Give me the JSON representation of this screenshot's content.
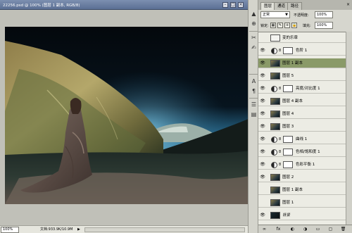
{
  "document": {
    "title": "22256.psd @ 100% (图层 1 副本, RGB/8)",
    "zoom": "100%",
    "doc_info": "文档:933.9K/10.9M",
    "status_arrow": "▶"
  },
  "window_buttons": {
    "minimize": "–",
    "maximize": "□",
    "close": "×"
  },
  "panel": {
    "tabs": [
      "图层",
      "通道",
      "路径"
    ],
    "close_symbol": "×",
    "blend_mode": "正常",
    "opacity_label": "不透明度:",
    "opacity_value": "100%",
    "lock_label": "锁定:",
    "fill_label": "填充:",
    "fill_value": "100%"
  },
  "layers": [
    {
      "name": "变的乐章",
      "kind": "text",
      "selected": false,
      "visible": false
    },
    {
      "name": "色阶 1",
      "kind": "adjustment",
      "selected": false,
      "visible": true
    },
    {
      "name": "图层 1 副本",
      "kind": "image",
      "selected": true,
      "visible": true
    },
    {
      "name": "图层 5",
      "kind": "image",
      "selected": false,
      "visible": true
    },
    {
      "name": "亮度/对比度 1",
      "kind": "adjustment",
      "selected": false,
      "visible": true
    },
    {
      "name": "图层 4 副本",
      "kind": "image",
      "selected": false,
      "visible": true
    },
    {
      "name": "图层 4",
      "kind": "image",
      "selected": false,
      "visible": true
    },
    {
      "name": "图层 3",
      "kind": "image",
      "selected": false,
      "visible": true
    },
    {
      "name": "曲线 1",
      "kind": "adjustment",
      "selected": false,
      "visible": true
    },
    {
      "name": "色相/饱和度 1",
      "kind": "adjustment",
      "selected": false,
      "visible": true
    },
    {
      "name": "色彩平衡 1",
      "kind": "adjustment",
      "selected": false,
      "visible": true
    },
    {
      "name": "图层 2",
      "kind": "image",
      "selected": false,
      "visible": true
    },
    {
      "name": "图层 1 副本",
      "kind": "image",
      "selected": false,
      "visible": false
    },
    {
      "name": "图层 1",
      "kind": "image",
      "selected": false,
      "visible": false
    },
    {
      "name": "背景",
      "kind": "background",
      "selected": false,
      "visible": true
    }
  ],
  "icons": {
    "eye": "👁",
    "chain": "8",
    "tools": [
      "▲",
      "⊕",
      "✂",
      "✍",
      "A",
      "¶",
      "☰",
      "▤"
    ],
    "locks": [
      "▦",
      "✎",
      "✛",
      "🔒"
    ],
    "bottom": [
      "∞",
      "fx",
      "◐",
      "◑",
      "▭",
      "▢",
      "🗑"
    ]
  },
  "colors": {
    "selected_row": "#8a9a68",
    "title_bar": "#5b6f94",
    "panel_bg": "#d6d6ce"
  }
}
